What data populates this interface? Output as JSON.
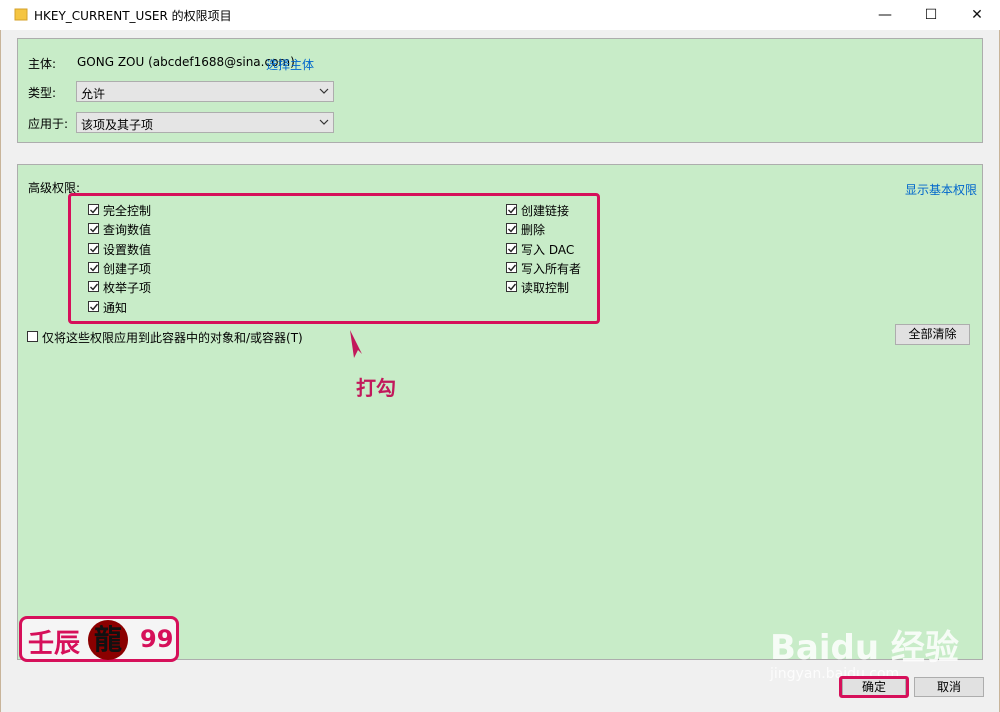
{
  "window": {
    "title": "HKEY_CURRENT_USER 的权限项目",
    "minimize": "—",
    "maximize": "☐",
    "close": "✕"
  },
  "principal": {
    "label": "主体:",
    "value": "GONG ZOU (abcdef1688@sina.com)",
    "select_link": "选择主体"
  },
  "type": {
    "label": "类型:",
    "value": "允许"
  },
  "applies_to": {
    "label": "应用于:",
    "value": "该项及其子项"
  },
  "advanced": {
    "label": "高级权限:",
    "show_basic_link": "显示基本权限",
    "left_permissions": [
      {
        "label": "完全控制",
        "checked": true
      },
      {
        "label": "查询数值",
        "checked": true
      },
      {
        "label": "设置数值",
        "checked": true
      },
      {
        "label": "创建子项",
        "checked": true
      },
      {
        "label": "枚举子项",
        "checked": true
      },
      {
        "label": "通知",
        "checked": true
      }
    ],
    "right_permissions": [
      {
        "label": "创建链接",
        "checked": true
      },
      {
        "label": "删除",
        "checked": true
      },
      {
        "label": "写入 DAC",
        "checked": true
      },
      {
        "label": "写入所有者",
        "checked": true
      },
      {
        "label": "读取控制",
        "checked": true
      }
    ]
  },
  "apply_only": {
    "label": "仅将这些权限应用到此容器中的对象和/或容器(T)",
    "checked": false
  },
  "clear_all_button": "全部清除",
  "annotation": "打勾",
  "ok_button": "确定",
  "cancel_button": "取消",
  "badge": {
    "left_text": "壬辰",
    "logo_char": "龍",
    "right_text": "99"
  },
  "watermark": {
    "main": "Baidu 经验",
    "sub": "jingyan.baidu.com"
  },
  "colors": {
    "panel_bg": "#c8ecc8",
    "highlight": "#d6105a",
    "link": "#0066cc"
  }
}
